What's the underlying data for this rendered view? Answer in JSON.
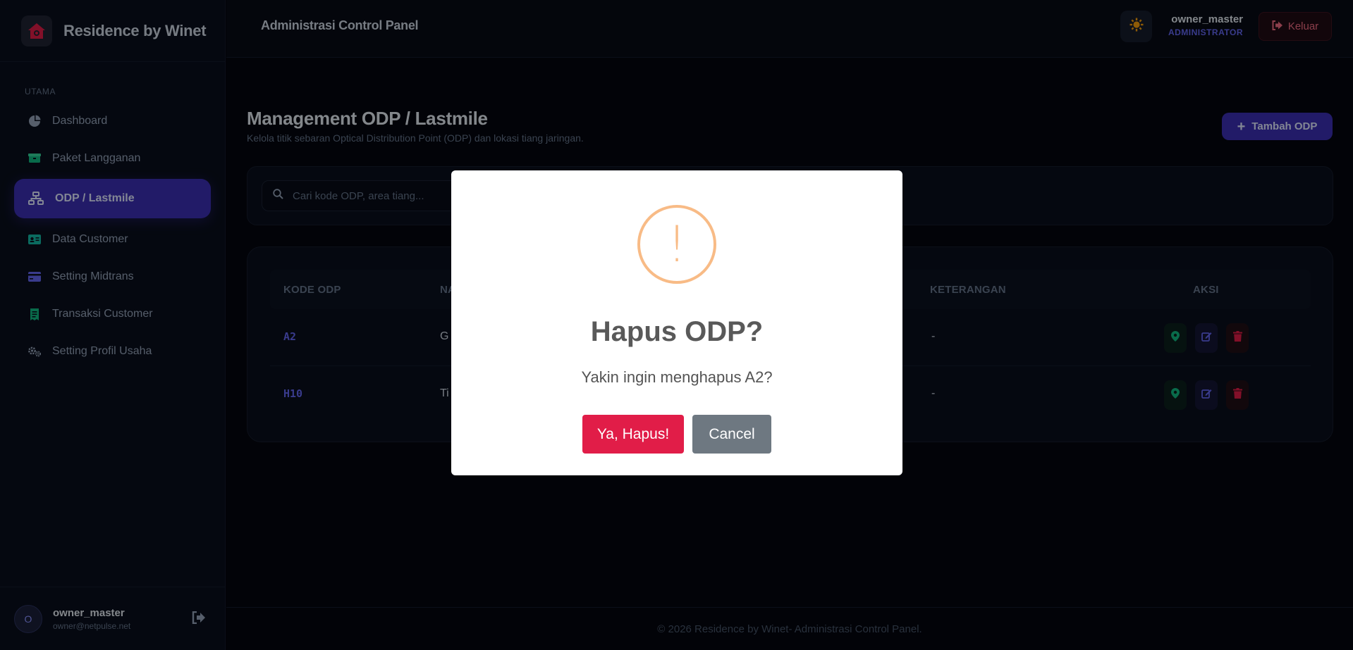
{
  "brand": {
    "name": "Residence by Winet"
  },
  "sidebar": {
    "section_label": "UTAMA",
    "items": [
      {
        "label": "Dashboard",
        "icon": "pie-chart-icon"
      },
      {
        "label": "Paket Langganan",
        "icon": "box-icon"
      },
      {
        "label": "ODP / Lastmile",
        "icon": "network-icon",
        "active": true
      },
      {
        "label": "Data Customer",
        "icon": "id-card-icon"
      },
      {
        "label": "Setting Midtrans",
        "icon": "credit-card-icon"
      },
      {
        "label": "Transaksi Customer",
        "icon": "receipt-icon"
      },
      {
        "label": "Setting Profil Usaha",
        "icon": "gears-icon"
      }
    ],
    "user": {
      "initial": "O",
      "name": "owner_master",
      "email": "owner@netpulse.net"
    }
  },
  "header": {
    "title": "Administrasi Control Panel",
    "user_name": "owner_master",
    "user_role": "ADMINISTRATOR",
    "logout_label": "Keluar"
  },
  "main": {
    "title": "Management ODP / Lastmile",
    "subtitle": "Kelola titik sebaran Optical Distribution Point (ODP) dan lokasi tiang jaringan.",
    "add_label": "Tambah ODP",
    "search_placeholder": "Cari kode ODP, area tiang...",
    "table": {
      "columns": [
        "KODE ODP",
        "NA",
        "KETERANGAN",
        "AKSI"
      ],
      "rows": [
        {
          "code": "A2",
          "name": "G",
          "note": "-"
        },
        {
          "code": "H10",
          "name": "Ti",
          "note": "-"
        }
      ]
    }
  },
  "footer": {
    "text": "© 2026 Residence by Winet- Administrasi Control Panel."
  },
  "modal": {
    "icon": "!",
    "title": "Hapus ODP?",
    "text": "Yakin ingin menghapus A2?",
    "confirm_label": "Ya, Hapus!",
    "cancel_label": "Cancel"
  },
  "colors": {
    "accent": "#3b2fb4",
    "danger": "#e11d48",
    "warning": "#f8bb86"
  }
}
